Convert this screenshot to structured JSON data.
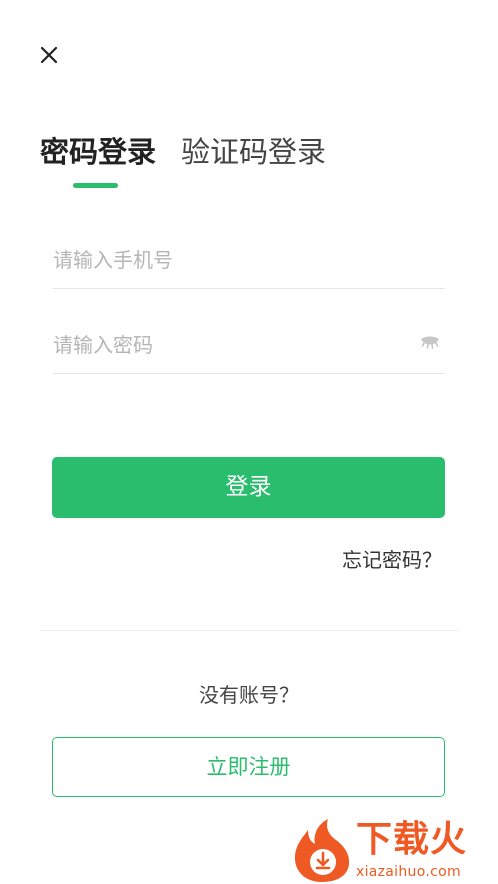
{
  "header": {
    "close_icon": "close-icon"
  },
  "tabs": [
    {
      "label": "密码登录",
      "active": true
    },
    {
      "label": "验证码登录",
      "active": false
    }
  ],
  "form": {
    "phone": {
      "value": "",
      "placeholder": "请输入手机号"
    },
    "password": {
      "value": "",
      "placeholder": "请输入密码",
      "toggle_icon": "eye-closed-icon"
    },
    "login_label": "登录",
    "forgot_label": "忘记密码？"
  },
  "register": {
    "prompt": "没有账号？",
    "button_label": "立即注册"
  },
  "watermark": {
    "title": "下载火",
    "domain": "xiazaihuo.com"
  },
  "colors": {
    "accent": "#2bbd6e",
    "watermark": "#ef5a24"
  }
}
